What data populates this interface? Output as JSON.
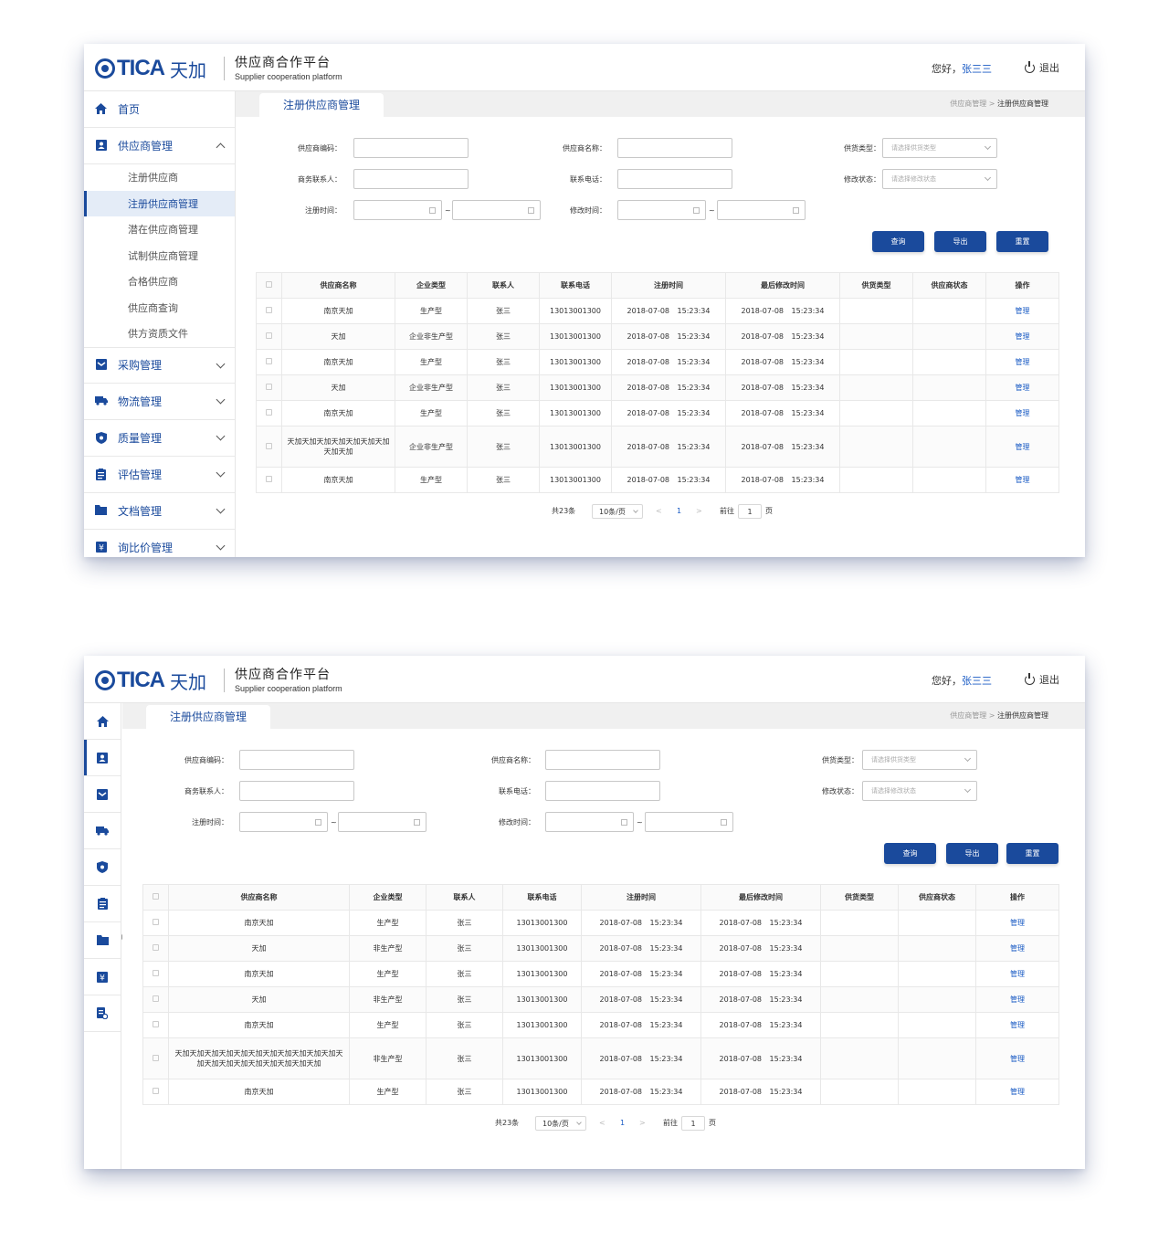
{
  "header": {
    "logo_en": "TICA",
    "logo_cn": "天加",
    "platform_cn": "供应商合作平台",
    "platform_en": "Supplier cooperation platform",
    "greeting": "您好，",
    "username": "张三三",
    "logout_label": "退出"
  },
  "sidebar": {
    "home": "首页",
    "supplier_mgmt": "供应商管理",
    "supplier_sub": [
      "注册供应商",
      "注册供应商管理",
      "潜在供应商管理",
      "试制供应商管理",
      "合格供应商",
      "供应商查询",
      "供方资质文件"
    ],
    "purchase_mgmt": "采购管理",
    "logistics_mgmt": "物流管理",
    "quality_mgmt": "质量管理",
    "evaluation_mgmt": "评估管理",
    "document_mgmt": "文档管理",
    "price_mgmt": "询比价管理",
    "icons": [
      "home-icon",
      "supplier-icon",
      "purchase-icon",
      "truck-icon",
      "shield-icon",
      "clipboard-icon",
      "folder-icon",
      "yen-icon",
      "report-icon"
    ]
  },
  "tab": {
    "label": "注册供应商管理"
  },
  "breadcrumb": {
    "parent": "供应商管理",
    "sep": ">",
    "current": "注册供应商管理"
  },
  "form": {
    "code_label": "供应商编码：",
    "name_label": "供应商名称：",
    "supply_type_label": "供货类型：",
    "supply_type_placeholder": "请选择供货类型",
    "contact_label": "商务联系人：",
    "phone_label": "联系电话：",
    "modify_status_label": "修改状态：",
    "modify_status_placeholder": "请选择修改状态",
    "reg_time_label": "注册时间：",
    "mod_time_label": "修改时间：",
    "tilde": "~"
  },
  "buttons": {
    "query": "查询",
    "export": "导出",
    "reset": "重置"
  },
  "table": {
    "headers": [
      "供应商名称",
      "企业类型",
      "联系人",
      "联系电话",
      "注册时间",
      "最后修改时间",
      "供货类型",
      "供应商状态",
      "操作"
    ],
    "op_label": "管理",
    "rows1": [
      [
        "南京天加",
        "生产型",
        "张三",
        "13013001300",
        "2018-07-08 15:23:34",
        "2018-07-08 15:23:34"
      ],
      [
        "天加",
        "企业非生产型",
        "张三",
        "13013001300",
        "2018-07-08 15:23:34",
        "2018-07-08 15:23:34"
      ],
      [
        "南京天加",
        "生产型",
        "张三",
        "13013001300",
        "2018-07-08 15:23:34",
        "2018-07-08 15:23:34"
      ],
      [
        "天加",
        "企业非生产型",
        "张三",
        "13013001300",
        "2018-07-08 15:23:34",
        "2018-07-08 15:23:34"
      ],
      [
        "南京天加",
        "生产型",
        "张三",
        "13013001300",
        "2018-07-08 15:23:34",
        "2018-07-08 15:23:34"
      ],
      [
        "天加天加天加天加天加天加天加天加天加",
        "企业非生产型",
        "张三",
        "13013001300",
        "2018-07-08 15:23:34",
        "2018-07-08 15:23:34"
      ],
      [
        "南京天加",
        "生产型",
        "张三",
        "13013001300",
        "2018-07-08 15:23:34",
        "2018-07-08 15:23:34"
      ]
    ],
    "rows2": [
      [
        "南京天加",
        "生产型",
        "张三",
        "13013001300",
        "2018-07-08 15:23:34",
        "2018-07-08 15:23:34"
      ],
      [
        "天加",
        "非生产型",
        "张三",
        "13013001300",
        "2018-07-08 15:23:34",
        "2018-07-08 15:23:34"
      ],
      [
        "南京天加",
        "生产型",
        "张三",
        "13013001300",
        "2018-07-08 15:23:34",
        "2018-07-08 15:23:34"
      ],
      [
        "天加",
        "非生产型",
        "张三",
        "13013001300",
        "2018-07-08 15:23:34",
        "2018-07-08 15:23:34"
      ],
      [
        "南京天加",
        "生产型",
        "张三",
        "13013001300",
        "2018-07-08 15:23:34",
        "2018-07-08 15:23:34"
      ],
      [
        "天加天加天加天加天加天加天加天加天加天加天加天加天加天加天加天加天加天加天加天加",
        "非生产型",
        "张三",
        "13013001300",
        "2018-07-08 15:23:34",
        "2018-07-08 15:23:34"
      ],
      [
        "南京天加",
        "生产型",
        "张三",
        "13013001300",
        "2018-07-08 15:23:34",
        "2018-07-08 15:23:34"
      ]
    ]
  },
  "pager": {
    "total": "共23条",
    "size": "10条/页",
    "prev": "<",
    "page": "1",
    "next": ">",
    "goto": "前往",
    "goto_value": "1",
    "page_unit": "页"
  }
}
